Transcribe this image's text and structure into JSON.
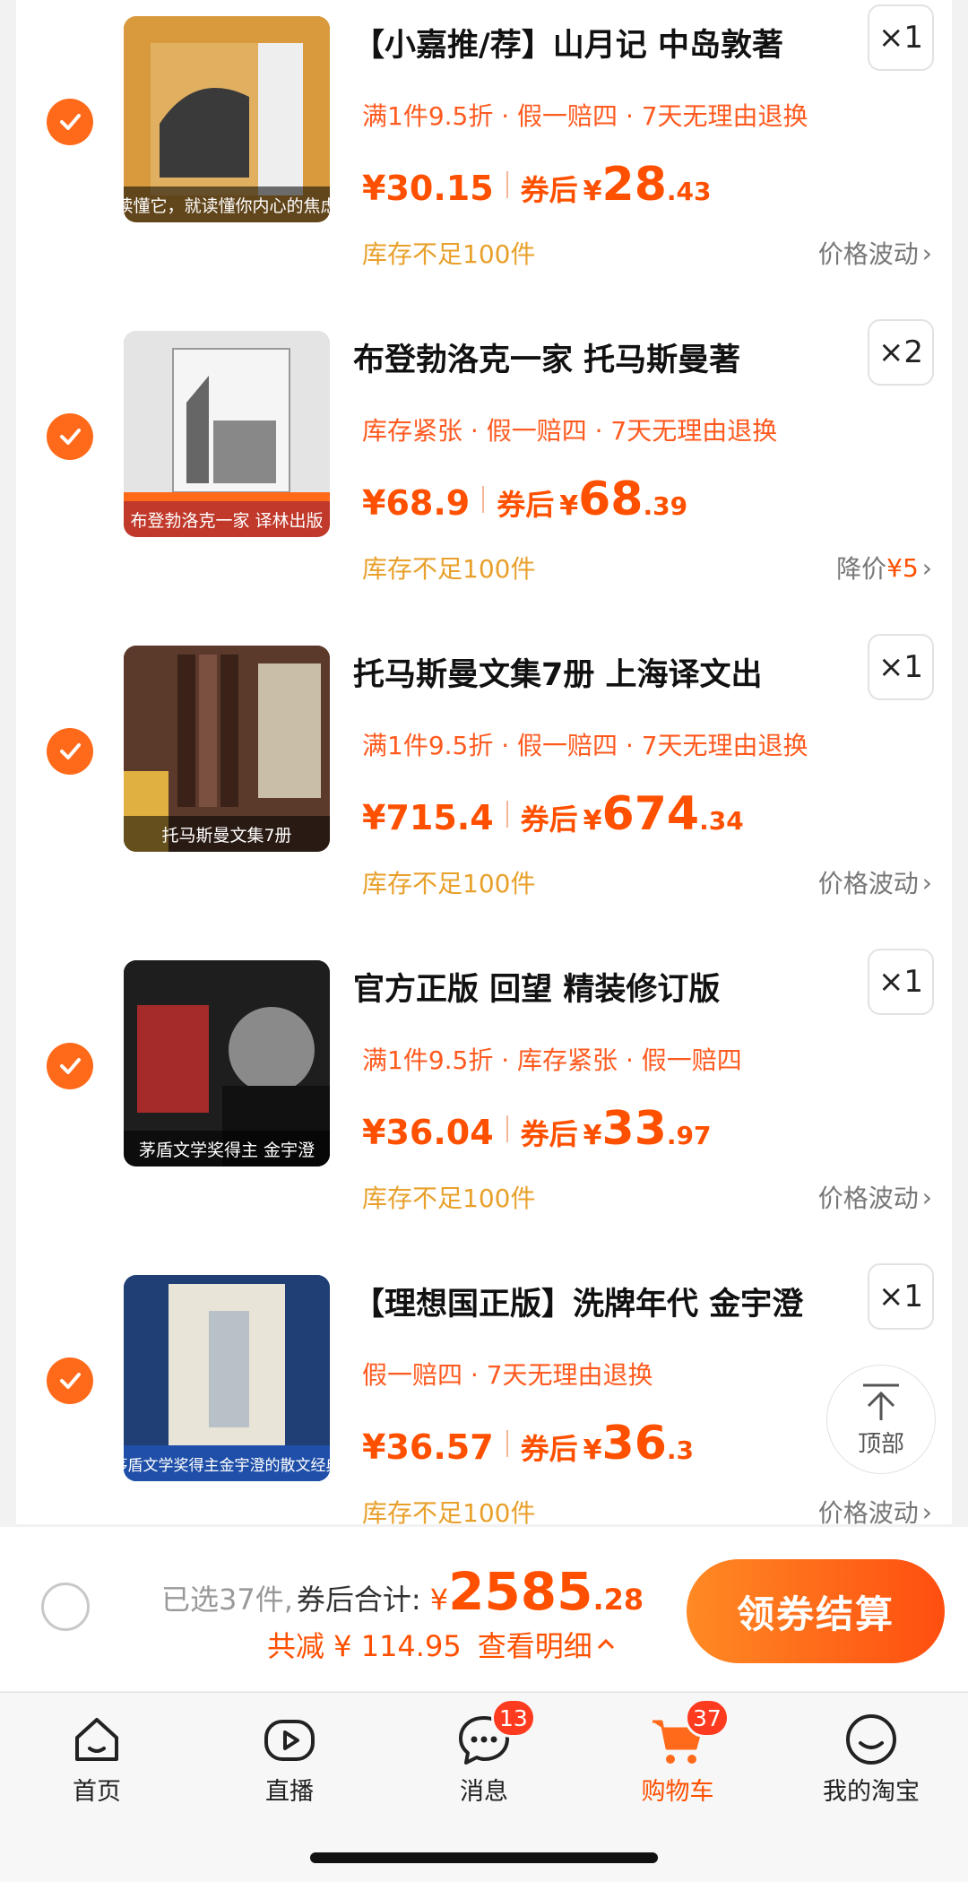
{
  "items": [
    {
      "title": "【小嘉推/荐】山月记 中岛敦著",
      "qty": "×1",
      "tags": "满1件9.5折 · 假一赔四 · 7天无理由退换",
      "price_original": "¥30.15",
      "after_label": "券后",
      "currency": "¥",
      "price_int": "28",
      "price_dec": ".43",
      "stock": "库存不足100件",
      "extra_text": "价格波动",
      "extra_highlight": "",
      "thumb_caption": "读懂它，就读懂你内心的焦虑",
      "thumb_color": "#d89a3c"
    },
    {
      "title": "布登勃洛克一家 托马斯曼著",
      "qty": "×2",
      "tags": "库存紧张 · 假一赔四 · 7天无理由退换",
      "price_original": "¥68.9",
      "after_label": "券后",
      "currency": "¥",
      "price_int": "68",
      "price_dec": ".39",
      "stock": "库存不足100件",
      "extra_text": "降价",
      "extra_highlight": "¥5",
      "thumb_caption": "布登勃洛克一家 译林出版",
      "thumb_color": "#b8b8b8"
    },
    {
      "title": "托马斯曼文集7册 上海译文出",
      "qty": "×1",
      "tags": "满1件9.5折 · 假一赔四 · 7天无理由退换",
      "price_original": "¥715.4",
      "after_label": "券后",
      "currency": "¥",
      "price_int": "674",
      "price_dec": ".34",
      "stock": "库存不足100件",
      "extra_text": "价格波动",
      "extra_highlight": "",
      "thumb_caption": "托马斯曼文集7册",
      "thumb_color": "#6b4a3a"
    },
    {
      "title": "官方正版 回望 精装修订版",
      "qty": "×1",
      "tags": "满1件9.5折 · 库存紧张 · 假一赔四",
      "price_original": "¥36.04",
      "after_label": "券后",
      "currency": "¥",
      "price_int": "33",
      "price_dec": ".97",
      "stock": "库存不足100件",
      "extra_text": "价格波动",
      "extra_highlight": "",
      "thumb_caption": "茅盾文学奖得主 金宇澄",
      "thumb_color": "#2b2b2b"
    },
    {
      "title": "【理想国正版】洗牌年代 金宇澄",
      "qty": "×1",
      "tags": "假一赔四 · 7天无理由退换",
      "price_original": "¥36.57",
      "after_label": "券后",
      "currency": "¥",
      "price_int": "36",
      "price_dec": ".3",
      "stock": "库存不足100件",
      "extra_text": "价格波动",
      "extra_highlight": "",
      "thumb_caption": "茅盾文学奖得主金宇澄的散文经典",
      "thumb_color": "#2a4f8a"
    }
  ],
  "top_button": {
    "label": "顶部"
  },
  "summary": {
    "selected_text": "已选37件,",
    "total_label": "券后合计:",
    "currency": "¥",
    "total_int": "2585",
    "total_dec": ".28",
    "saved_text": "共减 ¥ 114.95",
    "detail_text": "查看明细",
    "checkout_label": "领券结算"
  },
  "tabbar": {
    "tabs": [
      {
        "label": "首页",
        "icon": "home-icon",
        "badge": ""
      },
      {
        "label": "直播",
        "icon": "live-icon",
        "badge": ""
      },
      {
        "label": "消息",
        "icon": "message-icon",
        "badge": "13"
      },
      {
        "label": "购物车",
        "icon": "cart-icon",
        "badge": "37"
      },
      {
        "label": "我的淘宝",
        "icon": "profile-icon",
        "badge": ""
      }
    ]
  },
  "colors": {
    "accent": "#ff5000",
    "check": "#ff6a1a",
    "stock": "#e8a02b"
  }
}
